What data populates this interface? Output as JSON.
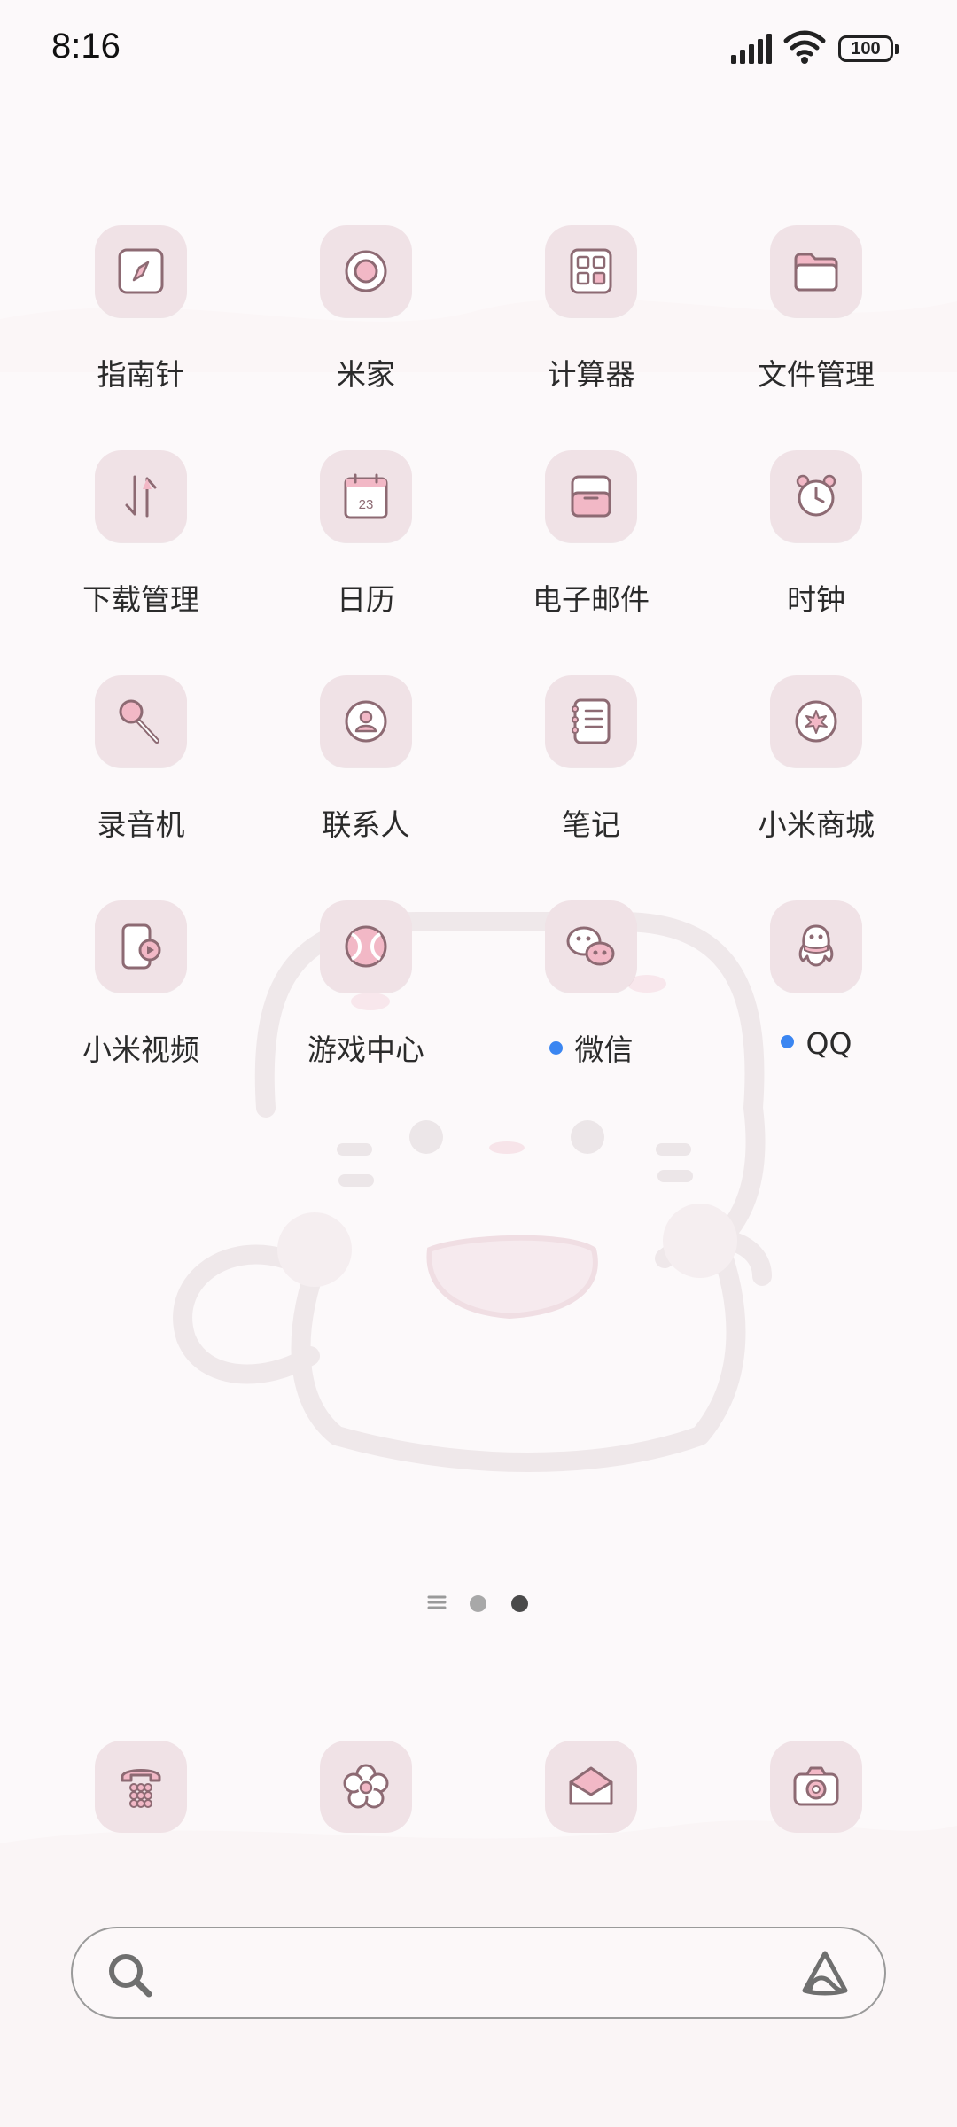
{
  "status_bar": {
    "time": "8:16",
    "battery": "100"
  },
  "apps": [
    {
      "label": "指南针",
      "icon": "compass-icon",
      "dot": false
    },
    {
      "label": "米家",
      "icon": "mijia-icon",
      "dot": false
    },
    {
      "label": "计算器",
      "icon": "calculator-icon",
      "dot": false
    },
    {
      "label": "文件管理",
      "icon": "folder-icon",
      "dot": false
    },
    {
      "label": "下载管理",
      "icon": "download-arrows-icon",
      "dot": false
    },
    {
      "label": "日历",
      "icon": "calendar-icon",
      "dot": false,
      "day": "23"
    },
    {
      "label": "电子邮件",
      "icon": "mailbox-icon",
      "dot": false
    },
    {
      "label": "时钟",
      "icon": "alarm-clock-icon",
      "dot": false
    },
    {
      "label": "录音机",
      "icon": "microphone-icon",
      "dot": false
    },
    {
      "label": "联系人",
      "icon": "contact-icon",
      "dot": false
    },
    {
      "label": "笔记",
      "icon": "notebook-icon",
      "dot": false
    },
    {
      "label": "小米商城",
      "icon": "mi-store-icon",
      "dot": false
    },
    {
      "label": "小米视频",
      "icon": "video-phone-icon",
      "dot": false
    },
    {
      "label": "游戏中心",
      "icon": "ball-icon",
      "dot": false
    },
    {
      "label": "微信",
      "icon": "wechat-icon",
      "dot": true
    },
    {
      "label": "QQ",
      "icon": "qq-penguin-icon",
      "dot": true
    }
  ],
  "dock": [
    {
      "icon": "phone-icon"
    },
    {
      "icon": "flower-icon"
    },
    {
      "icon": "envelope-icon"
    },
    {
      "icon": "camera-icon"
    }
  ],
  "pager": {
    "page_count": 2,
    "current_page": 2
  },
  "colors": {
    "accent_dot": "#3b86f1",
    "tile_bg": "#f0e2e6",
    "icon_line": "#8d6a73",
    "icon_fill": "#f2b8c6"
  }
}
